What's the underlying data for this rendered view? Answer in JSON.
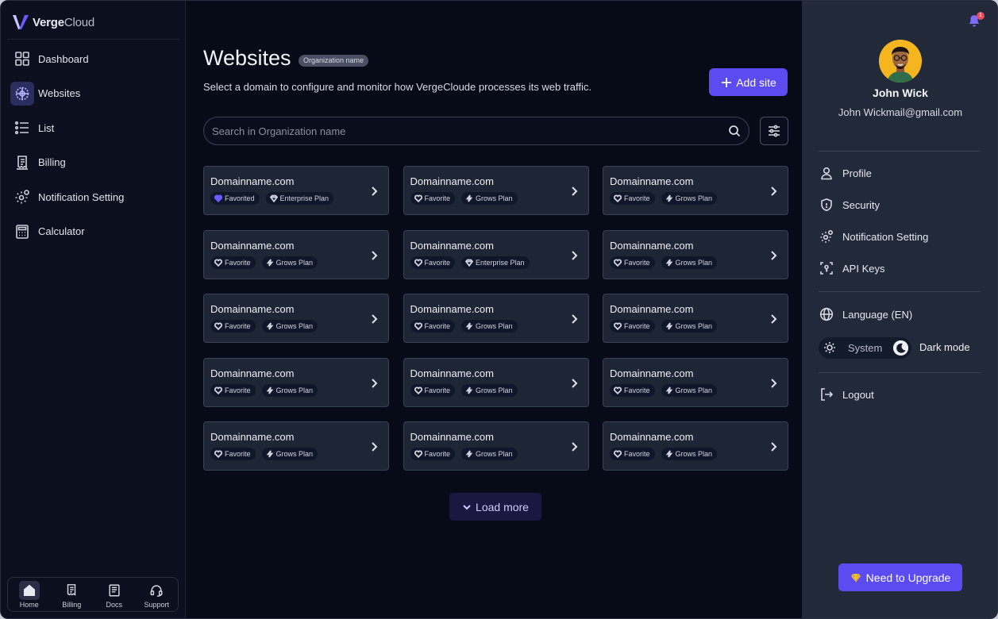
{
  "brand": {
    "name_bold": "Verge",
    "name_light": "Cloud"
  },
  "sidebar": {
    "items": [
      {
        "label": "Dashboard",
        "icon": "grid-icon"
      },
      {
        "label": "Websites",
        "icon": "globe-icon",
        "active": true
      },
      {
        "label": "List",
        "icon": "list-icon"
      },
      {
        "label": "Billing",
        "icon": "receipt-icon"
      },
      {
        "label": "Notification Setting",
        "icon": "gear-bell-icon"
      },
      {
        "label": "Calculator",
        "icon": "calculator-icon"
      }
    ],
    "bottom": [
      {
        "label": "Home",
        "icon": "home-icon",
        "active": true
      },
      {
        "label": "Billing",
        "icon": "receipt-icon"
      },
      {
        "label": "Docs",
        "icon": "book-icon"
      },
      {
        "label": "Support",
        "icon": "headset-icon"
      }
    ]
  },
  "main": {
    "title": "Websites",
    "org_badge": "Organization name",
    "subtitle": "Select a domain to configure and monitor how VergeCloude processes its web traffic.",
    "add_site_label": "Add site",
    "search_placeholder": "Search in Organization name",
    "load_more_label": "Load more",
    "cards": [
      {
        "name": "Domainname.com",
        "fav": "Favorited",
        "fav_active": true,
        "plan": "Enterprise Plan",
        "plan_icon": "diamond"
      },
      {
        "name": "Domainname.com",
        "fav": "Favorite",
        "fav_active": false,
        "plan": "Grows Plan",
        "plan_icon": "bolt"
      },
      {
        "name": "Domainname.com",
        "fav": "Favorite",
        "fav_active": false,
        "plan": "Grows Plan",
        "plan_icon": "bolt"
      },
      {
        "name": "Domainname.com",
        "fav": "Favorite",
        "fav_active": false,
        "plan": "Grows Plan",
        "plan_icon": "bolt"
      },
      {
        "name": "Domainname.com",
        "fav": "Favorite",
        "fav_active": false,
        "plan": "Enterprise Plan",
        "plan_icon": "diamond"
      },
      {
        "name": "Domainname.com",
        "fav": "Favorite",
        "fav_active": false,
        "plan": "Grows Plan",
        "plan_icon": "bolt"
      },
      {
        "name": "Domainname.com",
        "fav": "Favorite",
        "fav_active": false,
        "plan": "Grows Plan",
        "plan_icon": "bolt"
      },
      {
        "name": "Domainname.com",
        "fav": "Favorite",
        "fav_active": false,
        "plan": "Grows Plan",
        "plan_icon": "bolt"
      },
      {
        "name": "Domainname.com",
        "fav": "Favorite",
        "fav_active": false,
        "plan": "Grows Plan",
        "plan_icon": "bolt"
      },
      {
        "name": "Domainname.com",
        "fav": "Favorite",
        "fav_active": false,
        "plan": "Grows Plan",
        "plan_icon": "bolt"
      },
      {
        "name": "Domainname.com",
        "fav": "Favorite",
        "fav_active": false,
        "plan": "Grows Plan",
        "plan_icon": "bolt"
      },
      {
        "name": "Domainname.com",
        "fav": "Favorite",
        "fav_active": false,
        "plan": "Grows Plan",
        "plan_icon": "bolt"
      },
      {
        "name": "Domainname.com",
        "fav": "Favorite",
        "fav_active": false,
        "plan": "Grows Plan",
        "plan_icon": "bolt"
      },
      {
        "name": "Domainname.com",
        "fav": "Favorite",
        "fav_active": false,
        "plan": "Grows Plan",
        "plan_icon": "bolt"
      },
      {
        "name": "Domainname.com",
        "fav": "Favorite",
        "fav_active": false,
        "plan": "Grows Plan",
        "plan_icon": "bolt"
      }
    ]
  },
  "profile": {
    "notification_count": "1",
    "name": "John Wick",
    "email": "John Wickmail@gmail.com",
    "menu": [
      {
        "label": "Profile",
        "icon": "user-icon"
      },
      {
        "label": "Security",
        "icon": "shield-icon"
      },
      {
        "label": "Notification Setting",
        "icon": "gear-bell-icon"
      },
      {
        "label": "API Keys",
        "icon": "key-icon"
      }
    ],
    "language_label": "Language (EN)",
    "theme": {
      "system_label": "System",
      "dark_label": "Dark mode"
    },
    "logout_label": "Logout",
    "upgrade_label": "Need to Upgrade"
  },
  "colors": {
    "accent": "#5b4bf1",
    "card_bg": "#1e2535",
    "panel_bg": "#222a3a",
    "app_bg": "#070a17"
  }
}
